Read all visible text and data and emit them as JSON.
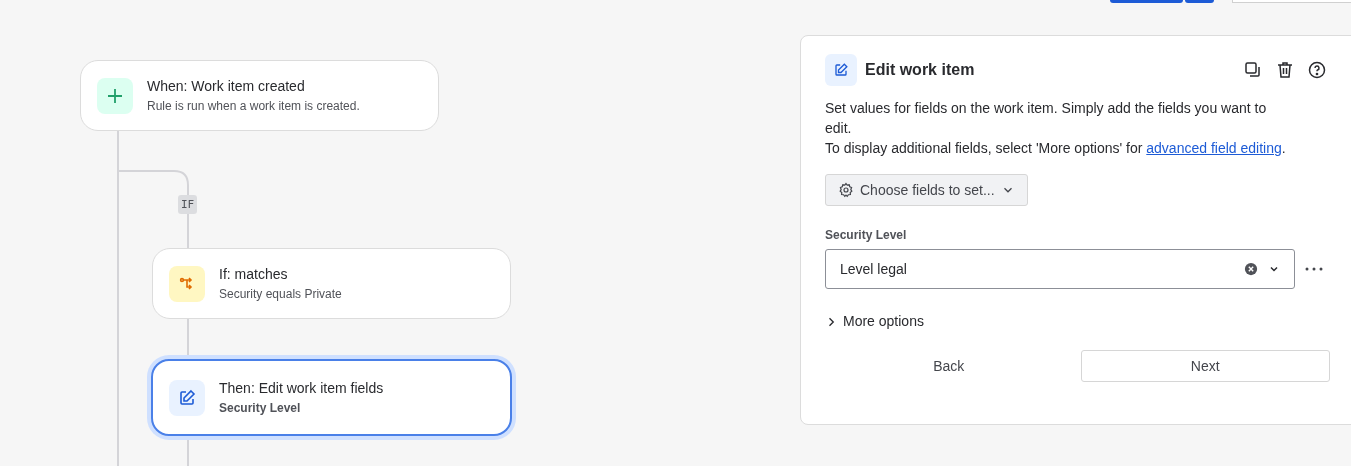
{
  "nodes": [
    {
      "kind": "trigger",
      "title": "When: Work item created",
      "subtitle": "Rule is run when a work item is created.",
      "selected": false
    },
    {
      "kind": "condition",
      "title": "If: matches",
      "subtitle": "Security equals Private",
      "selected": false
    },
    {
      "kind": "action",
      "title": "Then: Edit work item fields",
      "subtitle": "Security Level",
      "selected": true
    }
  ],
  "branch_label": "IF",
  "panel": {
    "title": "Edit work item",
    "description": "Set values for fields on the work item. Simply add the fields you want to edit.",
    "note": "To display additional fields, select 'More options' for ",
    "note_link": "advanced field editing",
    "note_end": ".",
    "choose_button": "Choose fields to set...",
    "field": {
      "label": "Security Level",
      "value": "Level legal"
    },
    "more_options": {
      "label": "More options",
      "expanded": false
    },
    "buttons": [
      "Back",
      "Next"
    ]
  }
}
